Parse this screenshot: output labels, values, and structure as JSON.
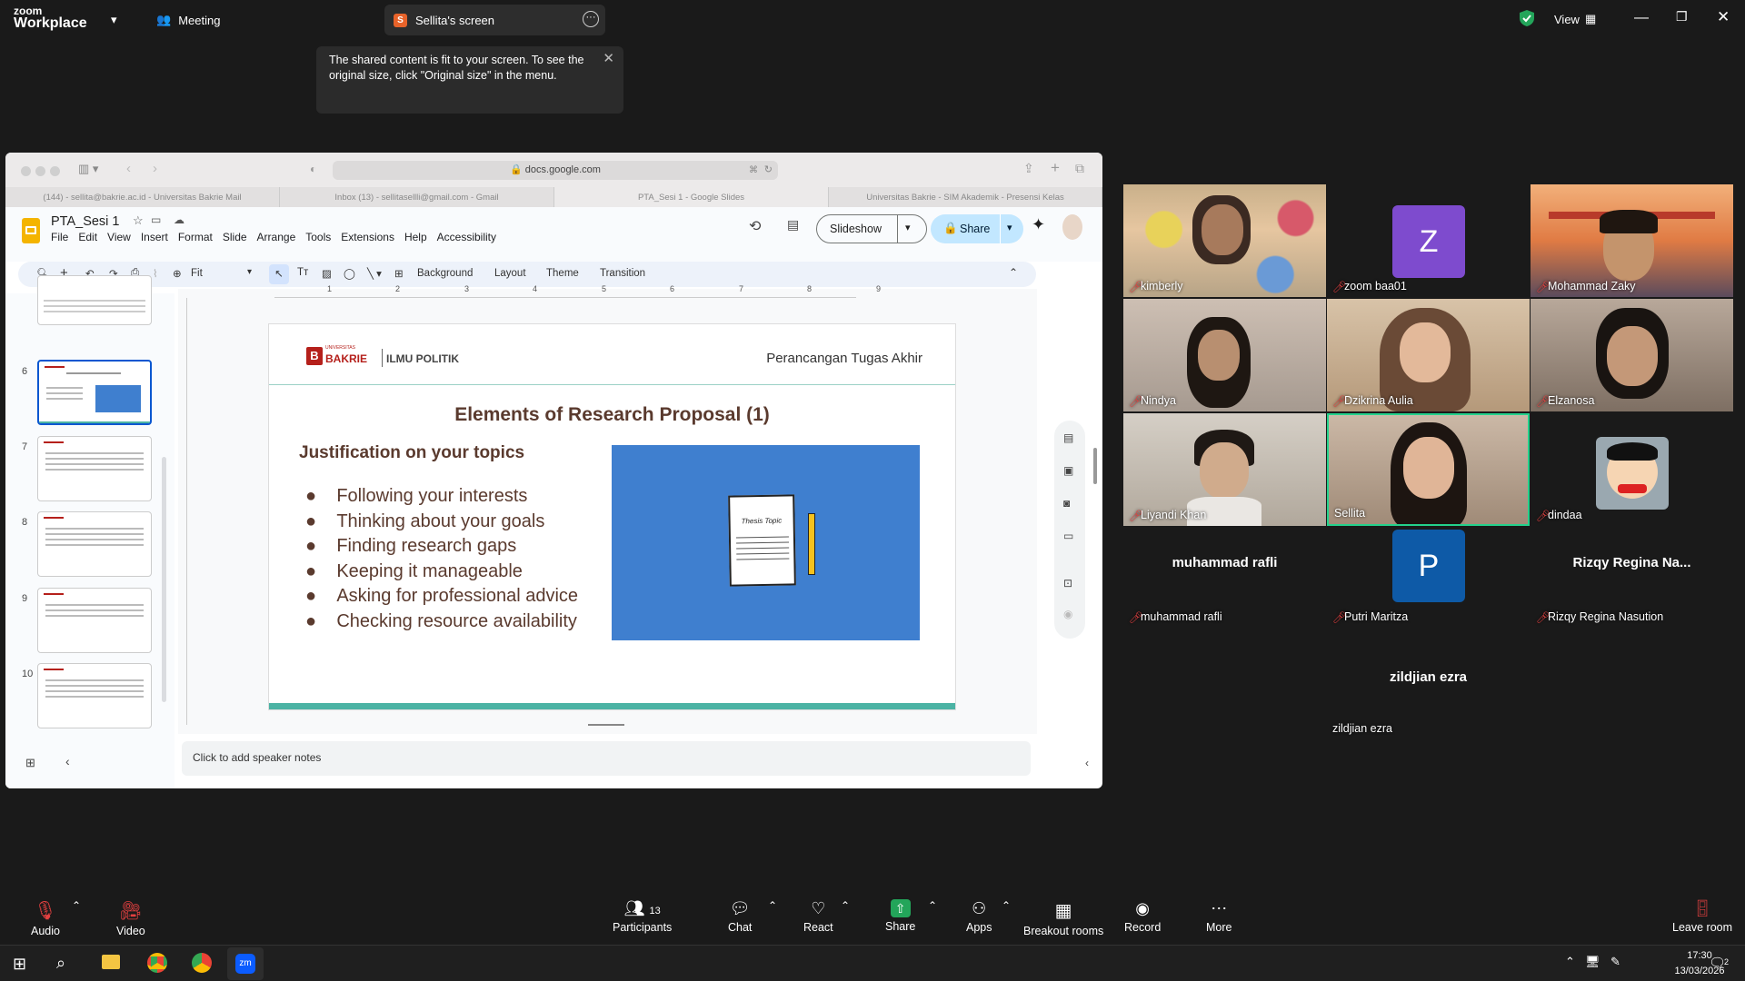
{
  "zoom": {
    "brand_top": "zoom",
    "brand_bottom": "Workplace",
    "meeting": "Meeting",
    "share_tab": "Sellita's screen",
    "share_tab_initial": "S",
    "view": "View"
  },
  "tooltip": {
    "text": "The shared content is fit to your screen. To see the original size, click \"Original size\" in the menu."
  },
  "browser": {
    "url": "docs.google.com",
    "tabs": [
      "(144) - sellita@bakrie.ac.id - Universitas Bakrie Mail",
      "Inbox (13) - sellitasellli@gmail.com - Gmail",
      "PTA_Sesi 1 - Google Slides",
      "Universitas Bakrie - SIM Akademik - Presensi Kelas"
    ]
  },
  "docs": {
    "title": "PTA_Sesi 1",
    "menus": [
      "File",
      "Edit",
      "View",
      "Insert",
      "Format",
      "Slide",
      "Arrange",
      "Tools",
      "Extensions",
      "Help",
      "Accessibility"
    ],
    "slideshow": "Slideshow",
    "share": "Share",
    "zoom": "Fit",
    "toolbar_items": [
      "Background",
      "Layout",
      "Theme",
      "Transition"
    ],
    "slide_numbers": [
      "6",
      "7",
      "8",
      "9",
      "10"
    ],
    "ruler": [
      "1",
      "2",
      "3",
      "4",
      "5",
      "6",
      "7",
      "8",
      "9"
    ],
    "notes": "Click to add speaker notes"
  },
  "slide": {
    "logo_main": "BAKRIE",
    "logo_side": "ILMU POLITIK",
    "logo_tiny": "UNIVERSITAS",
    "course": "Perancangan Tugas Akhir",
    "title": "Elements of Research Proposal (1)",
    "subtitle": "Justification on your topics",
    "bullets": [
      "Following your interests",
      "Thinking about your goals",
      "Finding research gaps",
      "Keeping it manageable",
      "Asking for professional advice",
      "Checking resource availability"
    ],
    "paper_label": "Thesis Topic",
    "colors": {
      "brand": "#b5201b",
      "teal": "#4bb3a4",
      "image_bg": "#3f7fcf"
    }
  },
  "participants": [
    {
      "name": "kimberly"
    },
    {
      "name": "zoom baa01",
      "initial": "Z"
    },
    {
      "name": "Mohammad Zaky"
    },
    {
      "name": "Nindya"
    },
    {
      "name": "Dzikrina Aulia"
    },
    {
      "name": "Elzanosa"
    },
    {
      "name": "Liyandi Khan"
    },
    {
      "name": "Sellita"
    },
    {
      "name": "dindaa"
    },
    {
      "name": "muhammad rafli",
      "big": "muhammad rafli"
    },
    {
      "name": "Putri Maritza",
      "initial": "P"
    },
    {
      "name": "Rizqy Regina Nasution",
      "big": "Rizqy Regina Na..."
    },
    {
      "name": "zildjian ezra",
      "big": "zildjian ezra"
    }
  ],
  "controls": {
    "audio": "Audio",
    "video": "Video",
    "participants": "Participants",
    "participant_count": "13",
    "chat": "Chat",
    "react": "React",
    "share": "Share",
    "apps": "Apps",
    "breakout": "Breakout rooms",
    "record": "Record",
    "more": "More",
    "leave": "Leave room"
  },
  "taskbar": {
    "time": "17:30",
    "date": "13/03/2026",
    "notif": "2"
  }
}
